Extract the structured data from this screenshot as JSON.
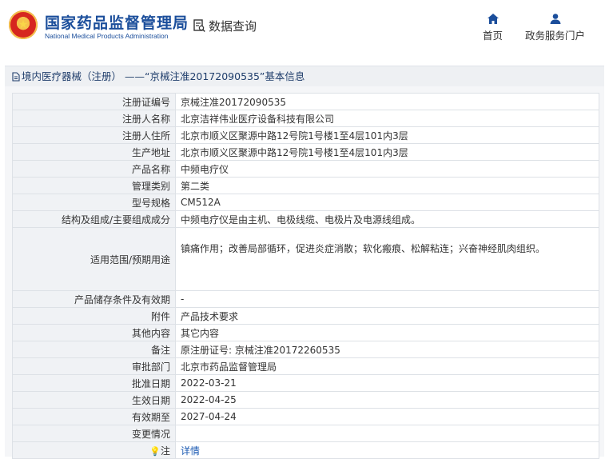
{
  "header": {
    "brand_cn": "国家药品监督管理局",
    "brand_en": "National Medical Products Administration",
    "query_label": "数据查询",
    "nav": {
      "home": "首页",
      "service": "政务服务门户"
    }
  },
  "breadcrumb": "境内医疗器械（注册） ——“京械注准20172090535”基本信息",
  "rows": [
    {
      "label": "注册证编号",
      "value": "京械注准20172090535"
    },
    {
      "label": "注册人名称",
      "value": "北京洁祥伟业医疗设备科技有限公司"
    },
    {
      "label": "注册人住所",
      "value": "北京市顺义区聚源中路12号院1号楼1至4层101内3层"
    },
    {
      "label": "生产地址",
      "value": "北京市顺义区聚源中路12号院1号楼1至4层101内3层"
    },
    {
      "label": "产品名称",
      "value": "中频电疗仪"
    },
    {
      "label": "管理类别",
      "value": "第二类"
    },
    {
      "label": "型号规格",
      "value": "CM512A"
    },
    {
      "label": "结构及组成/主要组成成分",
      "value": "中频电疗仪是由主机、电极线缆、电极片及电源线组成。"
    },
    {
      "label": "适用范围/预期用途",
      "value": "镇痛作用；改善局部循环，促进炎症消散；软化瘢痕、松解粘连；兴奋神经肌肉组织。"
    },
    {
      "label": "产品储存条件及有效期",
      "value": "-"
    },
    {
      "label": "附件",
      "value": "产品技术要求"
    },
    {
      "label": "其他内容",
      "value": "其它内容"
    },
    {
      "label": "备注",
      "value": "原注册证号: 京械注准20172260535"
    },
    {
      "label": "审批部门",
      "value": "北京市药品监督管理局"
    },
    {
      "label": "批准日期",
      "value": "2022-03-21"
    },
    {
      "label": "生效日期",
      "value": "2022-04-25"
    },
    {
      "label": "有效期至",
      "value": "2027-04-24"
    },
    {
      "label": "变更情况",
      "value": ""
    },
    {
      "label": "注",
      "value": "详情"
    }
  ],
  "icons": {
    "logo": "national-emblem-icon",
    "query": "document-search-icon",
    "home": "home-icon",
    "service": "user-icon",
    "note": "bulb-icon"
  },
  "colors": {
    "brand": "#1b4e9b",
    "link": "#1c5bb3"
  }
}
